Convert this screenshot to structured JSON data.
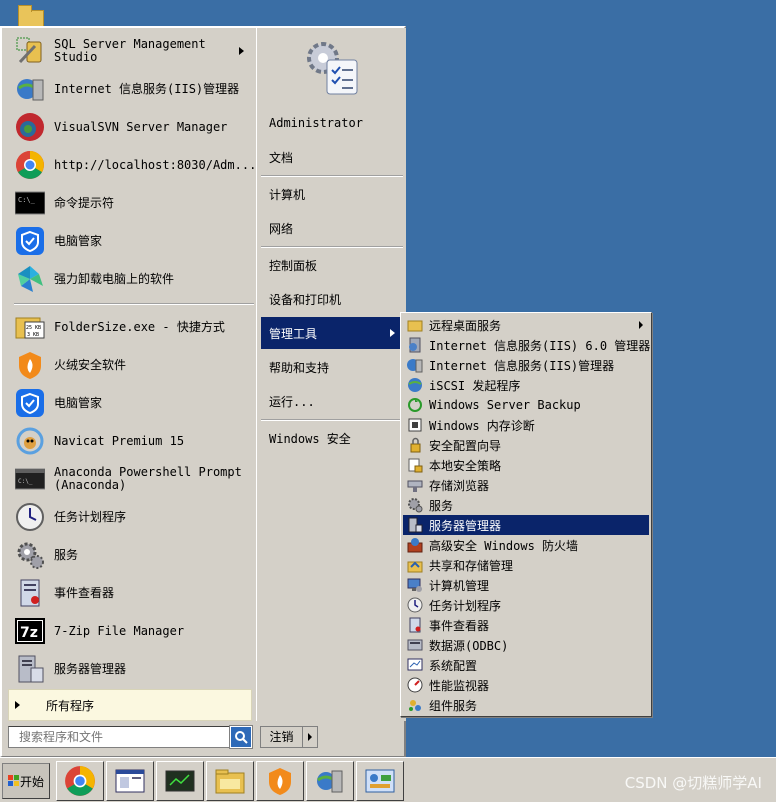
{
  "colors": {
    "desktop": "#3a6ea5",
    "menu_bg": "#d4d0c8",
    "highlight": "#0a246a",
    "all_programs_bg": "#fbf8e0"
  },
  "pinned_programs": [
    {
      "label": "SQL Server Management Studio",
      "icon": "sql-server-icon",
      "has_submenu": true
    },
    {
      "label": "Internet 信息服务(IIS)管理器",
      "icon": "iis-manager-icon"
    },
    {
      "label": "VisualSVN Server Manager",
      "icon": "visualsvn-icon"
    },
    {
      "label": "http://localhost:8030/Adm...",
      "icon": "chrome-icon"
    },
    {
      "label": "命令提示符",
      "icon": "command-prompt-icon"
    },
    {
      "label": "电脑管家",
      "icon": "tencent-pc-manager-icon"
    },
    {
      "label": "强力卸载电脑上的软件",
      "icon": "uninstaller-icon"
    }
  ],
  "recent_programs": [
    {
      "label": "FolderSize.exe - 快捷方式",
      "icon": "foldersize-icon"
    },
    {
      "label": "火绒安全软件",
      "icon": "huorong-icon"
    },
    {
      "label": "电脑管家",
      "icon": "tencent-pc-manager-icon"
    },
    {
      "label": "Navicat Premium 15",
      "icon": "navicat-icon"
    },
    {
      "label": "Anaconda Powershell Prompt\n(Anaconda)",
      "icon": "anaconda-prompt-icon"
    },
    {
      "label": "任务计划程序",
      "icon": "task-scheduler-icon"
    },
    {
      "label": "服务",
      "icon": "services-icon"
    },
    {
      "label": "事件查看器",
      "icon": "event-viewer-icon"
    },
    {
      "label": "7-Zip File Manager",
      "icon": "seven-zip-icon"
    },
    {
      "label": "服务器管理器",
      "icon": "server-manager-icon"
    }
  ],
  "all_programs_label": "所有程序",
  "search": {
    "placeholder": "搜索程序和文件"
  },
  "logoff_label": "注销",
  "places": {
    "user": "Administrator",
    "documents": "文档",
    "computer": "计算机",
    "network": "网络",
    "control_panel": "控制面板",
    "devices_printers": "设备和打印机",
    "admin_tools": "管理工具",
    "help": "帮助和支持",
    "run": "运行...",
    "windows_security": "Windows 安全"
  },
  "admin_tools_menu": [
    {
      "label": "远程桌面服务",
      "icon": "folder-icon",
      "has_submenu": true
    },
    {
      "label": "Internet 信息服务(IIS) 6.0 管理器",
      "icon": "iis6-manager-icon"
    },
    {
      "label": "Internet 信息服务(IIS)管理器",
      "icon": "iis-manager-icon"
    },
    {
      "label": "iSCSI 发起程序",
      "icon": "iscsi-icon"
    },
    {
      "label": "Windows Server Backup",
      "icon": "backup-icon"
    },
    {
      "label": "Windows 内存诊断",
      "icon": "memory-diagnostic-icon"
    },
    {
      "label": "安全配置向导",
      "icon": "security-wizard-icon"
    },
    {
      "label": "本地安全策略",
      "icon": "security-policy-icon"
    },
    {
      "label": "存储浏览器",
      "icon": "storage-explorer-icon"
    },
    {
      "label": "服务",
      "icon": "services-icon"
    },
    {
      "label": "服务器管理器",
      "icon": "server-manager-icon",
      "active": true
    },
    {
      "label": "高级安全 Windows 防火墙",
      "icon": "firewall-icon"
    },
    {
      "label": "共享和存储管理",
      "icon": "share-storage-icon"
    },
    {
      "label": "计算机管理",
      "icon": "computer-management-icon"
    },
    {
      "label": "任务计划程序",
      "icon": "task-scheduler-icon"
    },
    {
      "label": "事件查看器",
      "icon": "event-viewer-icon"
    },
    {
      "label": "数据源(ODBC)",
      "icon": "odbc-icon"
    },
    {
      "label": "系统配置",
      "icon": "system-config-icon"
    },
    {
      "label": "性能监视器",
      "icon": "performance-monitor-icon"
    },
    {
      "label": "组件服务",
      "icon": "component-services-icon"
    }
  ],
  "taskbar": {
    "start_label": "开始",
    "buttons": [
      "chrome-icon",
      "explorer-window-icon",
      "terminal-icon",
      "file-explorer-icon",
      "huorong-icon",
      "server-manager-icon",
      "control-panel-icon"
    ]
  },
  "watermark": "CSDN @切糕师学AI"
}
